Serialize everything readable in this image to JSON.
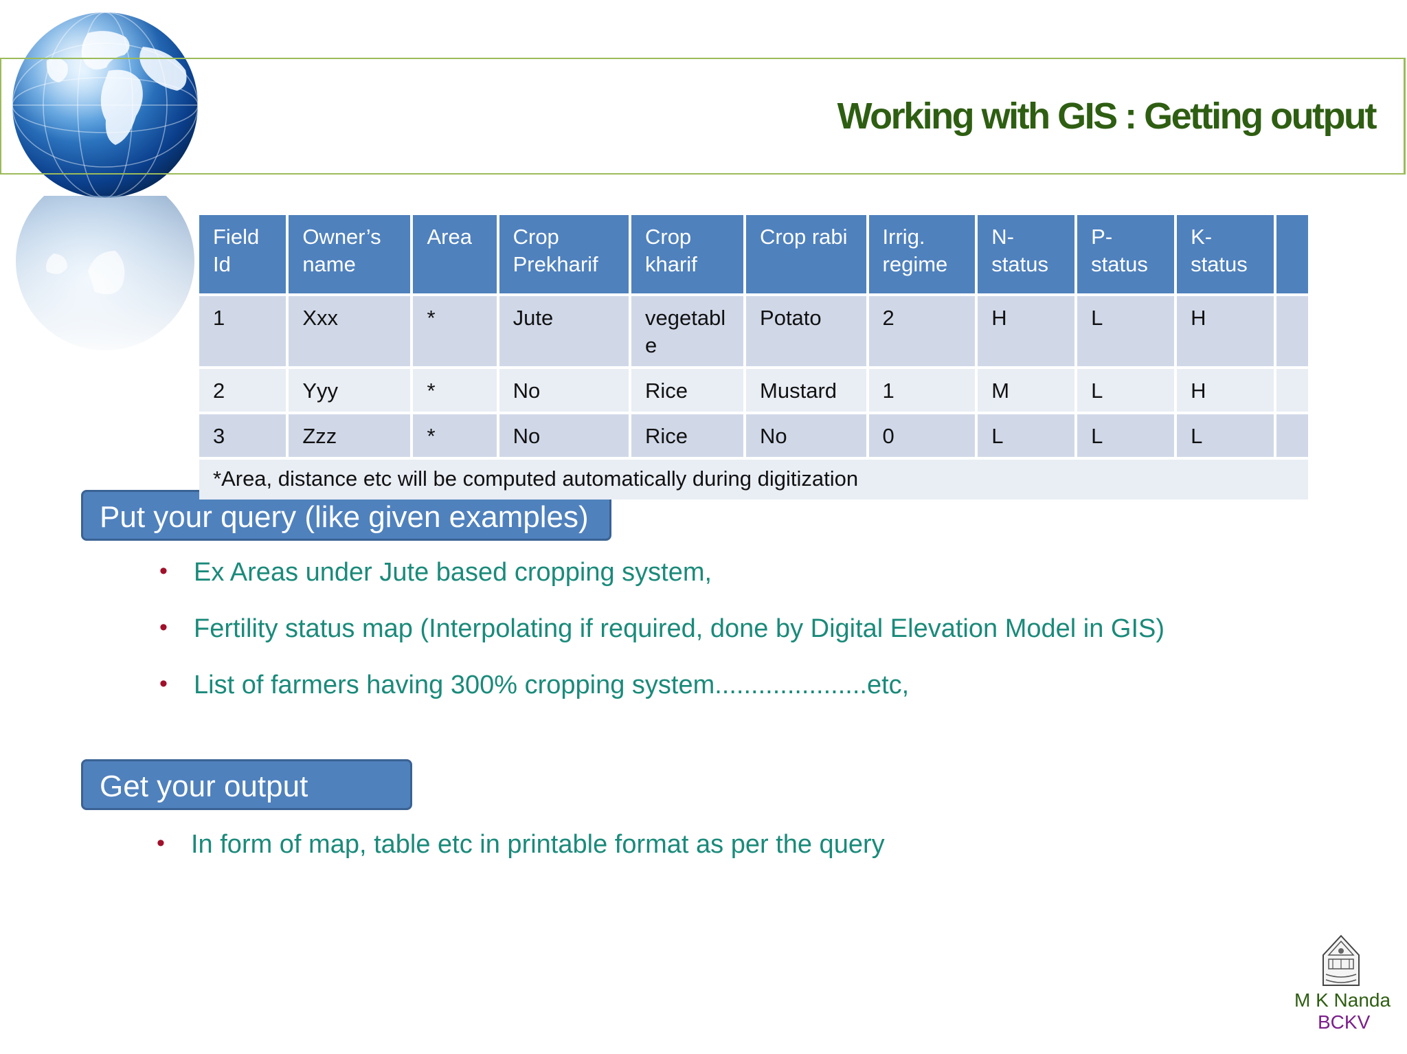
{
  "slide": {
    "title": "Working with GIS : Getting output"
  },
  "table": {
    "headers": [
      "Field Id",
      "Owner’s name",
      "Area",
      "Crop Prekharif",
      "Crop kharif",
      "Crop rabi",
      "Irrig. regime",
      "N-status",
      "P-status",
      "K-status",
      ""
    ],
    "rows": [
      [
        "1",
        "Xxx",
        "*",
        "Jute",
        "vegetable",
        "Potato",
        "2",
        "H",
        "L",
        "H",
        ""
      ],
      [
        "2",
        "Yyy",
        "*",
        "No",
        "Rice",
        "Mustard",
        "1",
        "M",
        "L",
        "H",
        ""
      ],
      [
        "3",
        "Zzz",
        "*",
        "No",
        "Rice",
        "No",
        "0",
        "L",
        "L",
        "L",
        ""
      ]
    ],
    "note": "*Area, distance etc will be computed automatically during digitization"
  },
  "query_section": {
    "label": "Put your query (like given examples)",
    "items": [
      "Ex Areas under Jute based cropping system,",
      "Fertility status map (Interpolating if required, done by Digital Elevation Model in  GIS)",
      "List of farmers having 300% cropping system.....................etc,"
    ]
  },
  "output_section": {
    "label": "Get your output",
    "items": [
      "In form of map, table etc in printable format as per the  query"
    ]
  },
  "footer": {
    "author": "M K Nanda",
    "institution": "BCKV"
  },
  "colors": {
    "title": "#2e5e12",
    "header_fill": "#4f81bd",
    "row_dark": "#d0d8e8",
    "row_light": "#e9edf4",
    "bullet_text": "#1a8a7a",
    "bullet_dot": "#a0102a",
    "frame": "#9bbb59"
  }
}
